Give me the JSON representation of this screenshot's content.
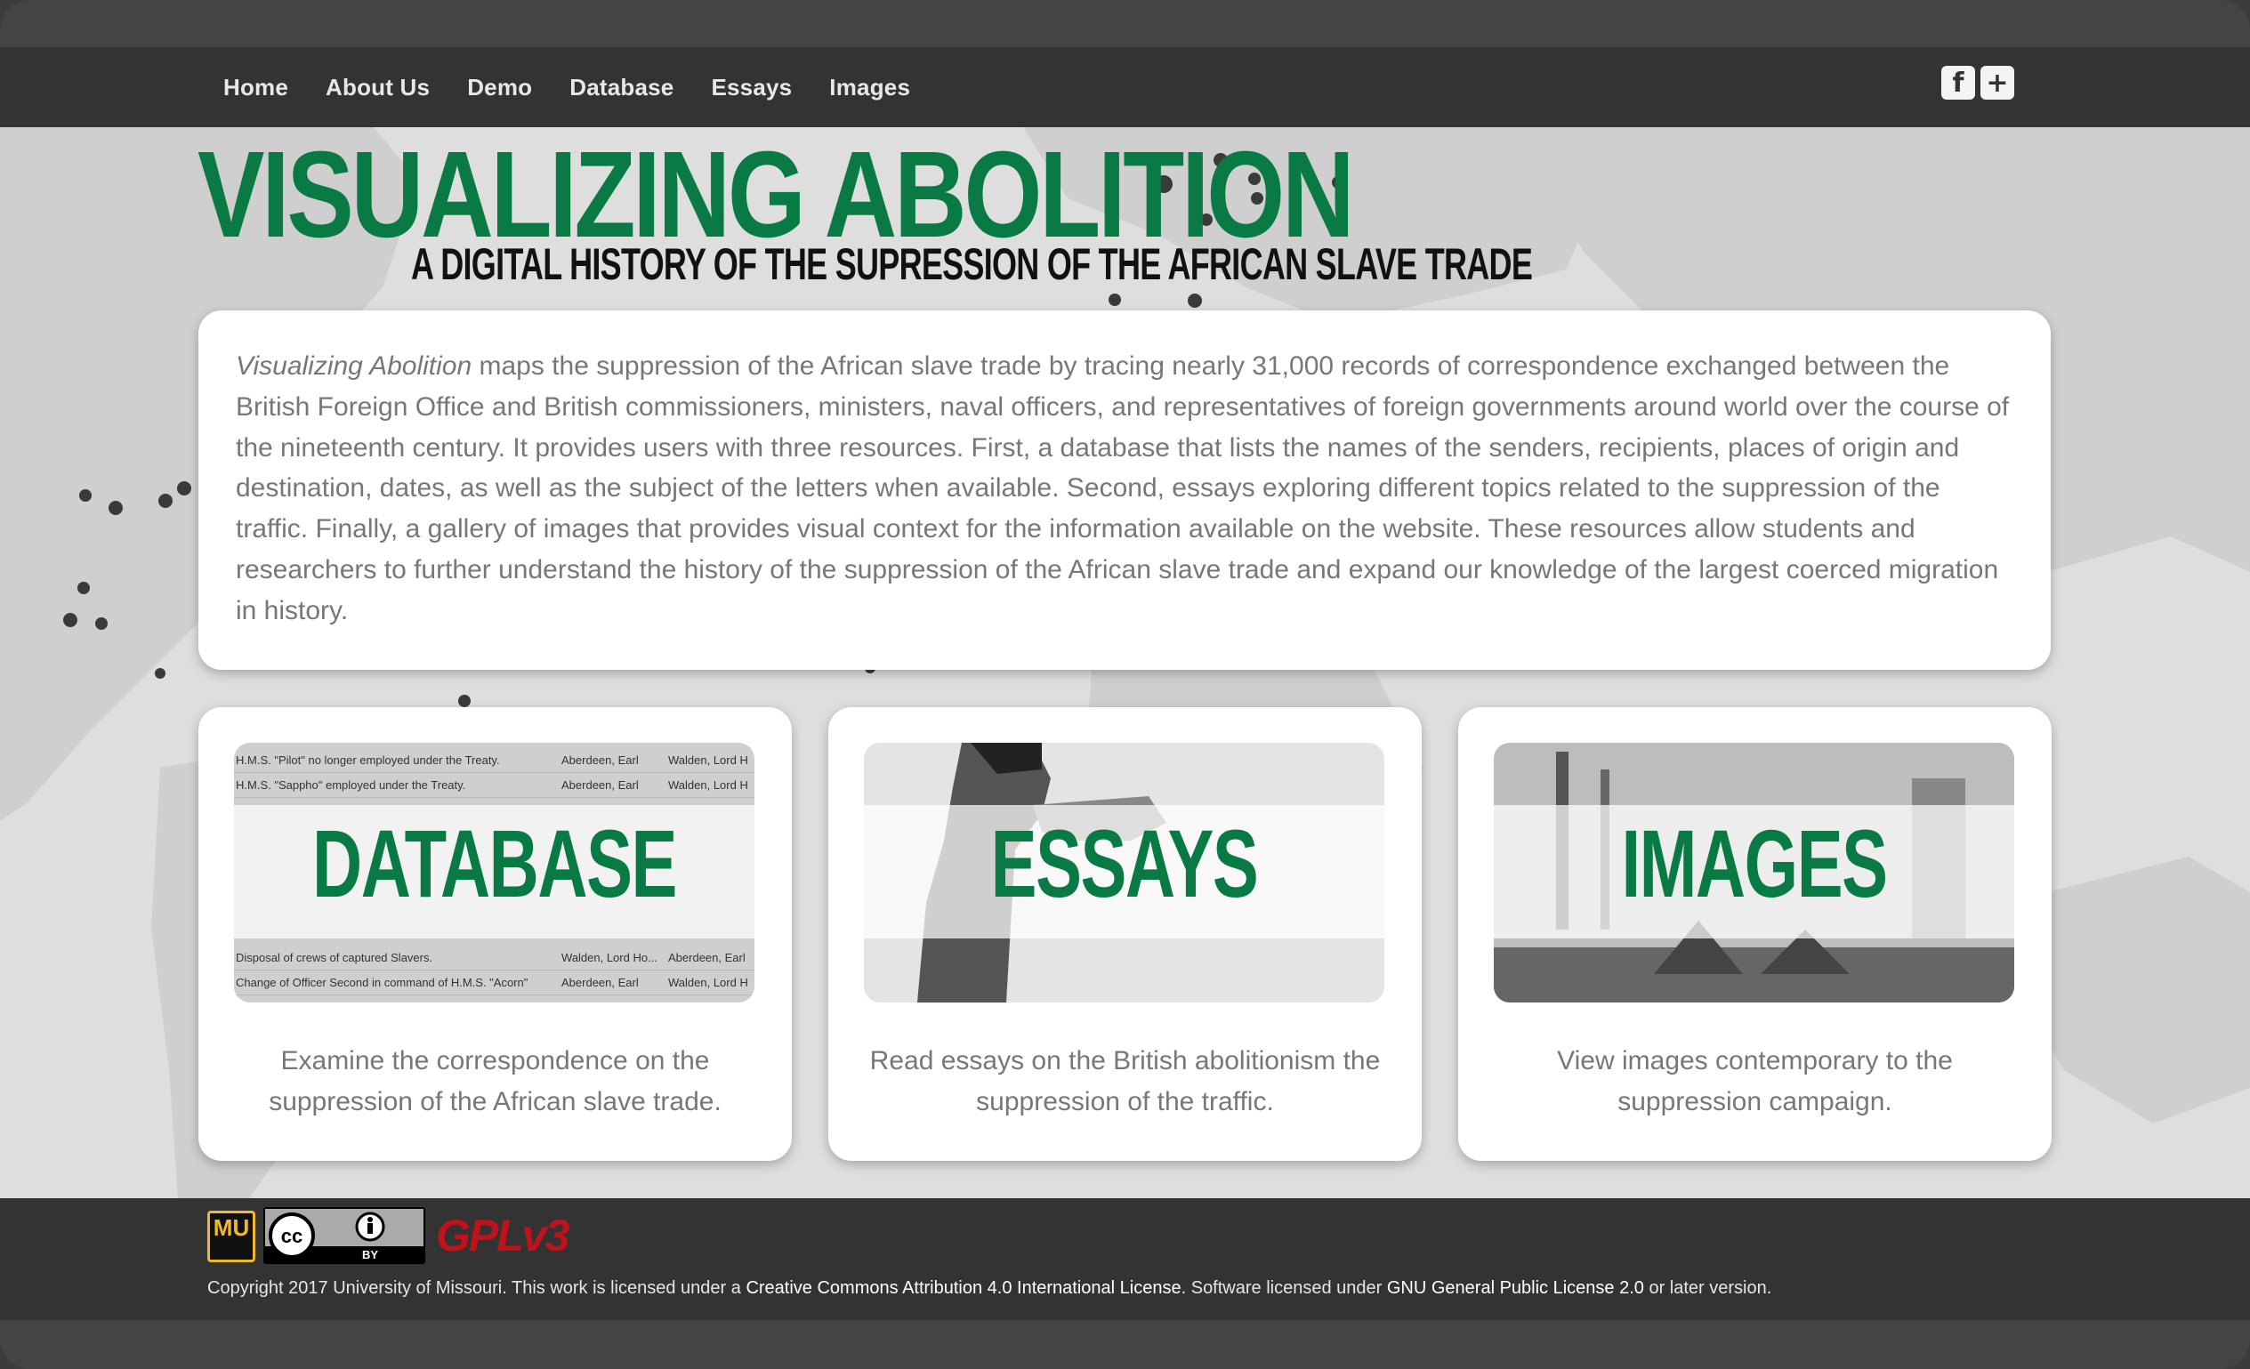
{
  "nav": {
    "items": [
      {
        "label": "Home"
      },
      {
        "label": "About Us"
      },
      {
        "label": "Demo"
      },
      {
        "label": "Database"
      },
      {
        "label": "Essays"
      },
      {
        "label": "Images"
      }
    ],
    "social": [
      {
        "icon": "facebook-icon",
        "glyph": "f"
      },
      {
        "icon": "google-plus-icon",
        "glyph": "+"
      }
    ]
  },
  "header": {
    "title": "VISUALIZING ABOLITION",
    "subtitle": "A DIGITAL HISTORY OF THE SUPRESSION OF THE AFRICAN SLAVE TRADE"
  },
  "intro": {
    "emphasis": "Visualizing Abolition",
    "text": " maps the suppression of the African slave trade by tracing nearly 31,000 records of correspondence exchanged between the British Foreign Office and British commissioners, ministers, naval officers, and representatives of foreign governments around world over the course of the nineteenth century. It provides users with three resources. First, a  database that lists the names of the senders, recipients, places of origin and destination, dates, as well as the subject of the letters when available. Second, essays exploring different topics related to the suppression of the traffic. Finally, a gallery of images that provides visual context for the information available on the website. These resources allow students and researchers to further understand the history of the suppression of the African slave trade and expand our knowledge of the largest coerced migration in history."
  },
  "cards": {
    "database": {
      "label": "DATABASE",
      "description": "Examine the correspondence on the suppression of the African slave trade.",
      "rows": [
        {
          "subject": "H.M.S. \"Pilot\" no longer employed under the Treaty.",
          "from": "Aberdeen, Earl",
          "to": "Walden, Lord H"
        },
        {
          "subject": "H.M.S. \"Sappho\" employed under the Treaty.",
          "from": "Aberdeen, Earl",
          "to": "Walden, Lord H"
        },
        {
          "subject": "Disposal of crews of captured Slavers.",
          "from": "Walden, Lord Ho...",
          "to": "Aberdeen, Earl"
        },
        {
          "subject": "Change of Officer Second in command of H.M.S. \"Acorn\"",
          "from": "Aberdeen, Earl",
          "to": "Walden, Lord H"
        }
      ]
    },
    "essays": {
      "label": "ESSAYS",
      "description": "Read essays on the British abolitionism the suppression of the traffic."
    },
    "images": {
      "label": "IMAGES",
      "description": "View images contemporary to the suppression campaign."
    }
  },
  "footer": {
    "logos": {
      "mu": "MU",
      "cc": "BY",
      "gpl": "GPLv3"
    },
    "copyright_prefix": "Copyright 2017 University of Missouri. This work is licensed under a ",
    "cc_link": "Creative Commons Attribution 4.0 International License",
    "middle": ". Software licensed under ",
    "gpl_link": "GNU General Public License 2.0",
    "suffix": " or later version."
  },
  "colors": {
    "accent_green": "#0a7a45",
    "nav_bg": "#333333",
    "map_bg": "#dedede"
  }
}
